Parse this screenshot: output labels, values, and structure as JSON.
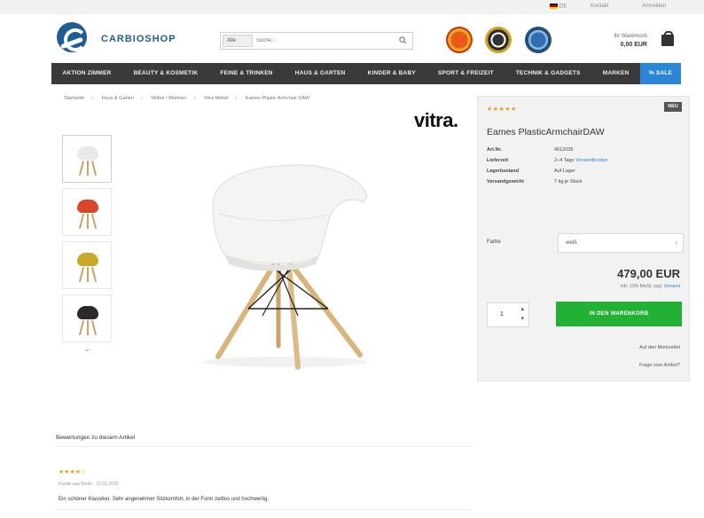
{
  "topbar": {
    "language": "DE",
    "links": [
      "Kontakt",
      "Anmelden"
    ]
  },
  "header": {
    "logo_text": "CARBIOSHOP",
    "search": {
      "scope": "Alle",
      "placeholder": "Suche..."
    },
    "cart": {
      "label": "Ihr Warenkorb",
      "total": "0,00 EUR"
    }
  },
  "nav": {
    "items": [
      "AKTION ZIMMER",
      "BEAUTY & KOSMETIK",
      "FEINE & TRINKEN",
      "HAUS & GARTEN",
      "KINDER & BABY",
      "SPORT & FREIZEIT",
      "TECHNIK & GADGETS",
      "MARKEN"
    ],
    "sale": "% SALE"
  },
  "breadcrumb": [
    "Startseite",
    "Haus & Garten",
    "Möbel / Wohnen",
    "Vitra Möbel",
    "Eames Plastic Armchair DAW"
  ],
  "brand_logo": "vitra.",
  "product": {
    "rating_stars": "★★★★★",
    "new_tag": "NEU",
    "title": "Eames PlasticArmchairDAW",
    "specs": [
      {
        "key": "Art.Nr.",
        "value": "4012035"
      },
      {
        "key": "Lieferzeit",
        "value": "2–4 Tage",
        "link": "Versandkosten"
      },
      {
        "key": "Lagerbestand",
        "value": "Auf Lager"
      },
      {
        "key": "Versandgewicht",
        "value": "7 kg je Stück"
      }
    ],
    "variant_label": "Farbe",
    "variant_value": "weiß",
    "price": "479,00 EUR",
    "tax_note": "inkl. 19% MwSt. zzgl.",
    "tax_link": "Versand",
    "quantity": "1",
    "add_to_cart": "IN DEN WARENKORB",
    "wishlist_link": "Auf den Merkzettel",
    "question_link": "Frage zum Artikel?"
  },
  "thumbnails": [
    {
      "color": "#e9e9e7"
    },
    {
      "color": "#d9472b"
    },
    {
      "color": "#c9a92a"
    },
    {
      "color": "#2a2a2a"
    }
  ],
  "reviews": {
    "title": "Bewertungen zu diesem Artikel",
    "items": [
      {
        "stars": "★★★★☆",
        "meta": "Kunde aus Berlin · 12.03.2016",
        "text": "Ein schöner Klassiker. Sehr angenehmer Sitzkomfort, in der Form zeitlos und hochwertig."
      }
    ]
  },
  "colors": {
    "nav_bg": "#3a3a3a",
    "sale_bg": "#2b86d6",
    "cart_button": "#22b035",
    "brand_blue": "#1f5d94",
    "star": "#f19a1f"
  }
}
